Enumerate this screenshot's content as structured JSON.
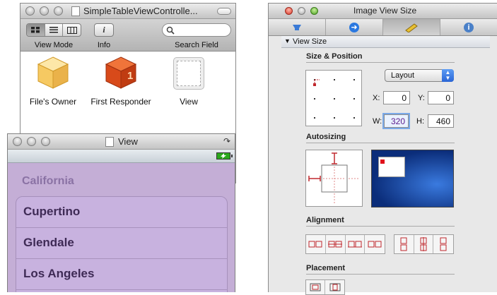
{
  "nib_window": {
    "title": "SimpleTableViewControlle...",
    "toolbar": {
      "view_mode_label": "View Mode",
      "info_label": "Info",
      "info_glyph": "i",
      "search_label": "Search Field",
      "search_placeholder": ""
    },
    "items": [
      {
        "label": "File's Owner",
        "icon": "cube-icon"
      },
      {
        "label": "First Responder",
        "icon": "first-responder-icon",
        "glyph": "1"
      },
      {
        "label": "View",
        "icon": "view-icon"
      }
    ]
  },
  "view_window": {
    "title": "View",
    "section_header": "California",
    "rows": [
      "Cupertino",
      "Glendale",
      "Los Angeles"
    ]
  },
  "inspector": {
    "title": "Image View Size",
    "tabs": [
      "attributes-tab",
      "connections-tab",
      "size-tab",
      "identity-tab"
    ],
    "info_glyph": "i",
    "panel_title": "View Size",
    "size_position": {
      "title": "Size & Position",
      "layout_popup": "Layout",
      "x_label": "X:",
      "x_value": "0",
      "y_label": "Y:",
      "y_value": "0",
      "w_label": "W:",
      "w_value": "320",
      "h_label": "H:",
      "h_value": "460"
    },
    "autosizing_title": "Autosizing",
    "alignment_title": "Alignment",
    "placement_title": "Placement"
  },
  "colors": {
    "accent_blue": "#2a65d6",
    "table_background": "#c4aed6",
    "autosizing_strut": "#c0282d",
    "preview_blue": "#0b2d7a"
  }
}
